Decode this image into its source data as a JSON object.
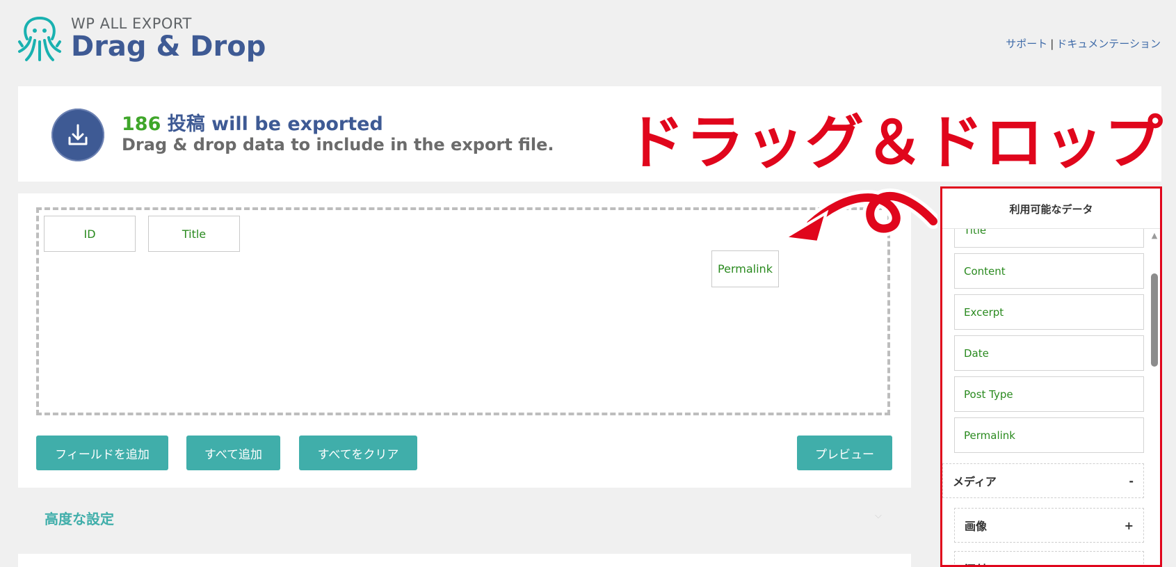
{
  "header": {
    "brand_small": "WP ALL EXPORT",
    "brand_big": "Drag & Drop",
    "links": {
      "support": "サポート",
      "separator": "|",
      "docs": "ドキュメンテーション"
    }
  },
  "info": {
    "count": "186",
    "count_rest": "投稿 will be exported",
    "subtitle": "Drag & drop data to include in the export file.",
    "annotation": "ドラッグ＆ドロップ"
  },
  "dropzone": {
    "fields": [
      "ID",
      "Title",
      "Permalink"
    ]
  },
  "buttons": {
    "add_field": "フィールドを追加",
    "add_all": "すべて追加",
    "clear_all": "すべてをクリア",
    "preview": "プレビュー"
  },
  "advanced": {
    "label": "高度な設定",
    "chevron": "⌵"
  },
  "sidebar": {
    "title": "利用可能なデータ",
    "fields": [
      "Title",
      "Content",
      "Excerpt",
      "Date",
      "Post Type",
      "Permalink"
    ],
    "groups": [
      {
        "label": "メディア",
        "toggle": "-"
      },
      {
        "label": "画像",
        "toggle": "+"
      },
      {
        "label": "添付",
        "toggle": ""
      }
    ]
  },
  "colors": {
    "accent_teal": "#40aeaa",
    "brand_blue": "#3e5a94",
    "field_green": "#2a8a1f",
    "annotation_red": "#e0061c"
  },
  "icons": [
    "octopus-logo-icon",
    "download-icon",
    "scroll-up-arrow-icon",
    "curved-arrow-annotation"
  ]
}
